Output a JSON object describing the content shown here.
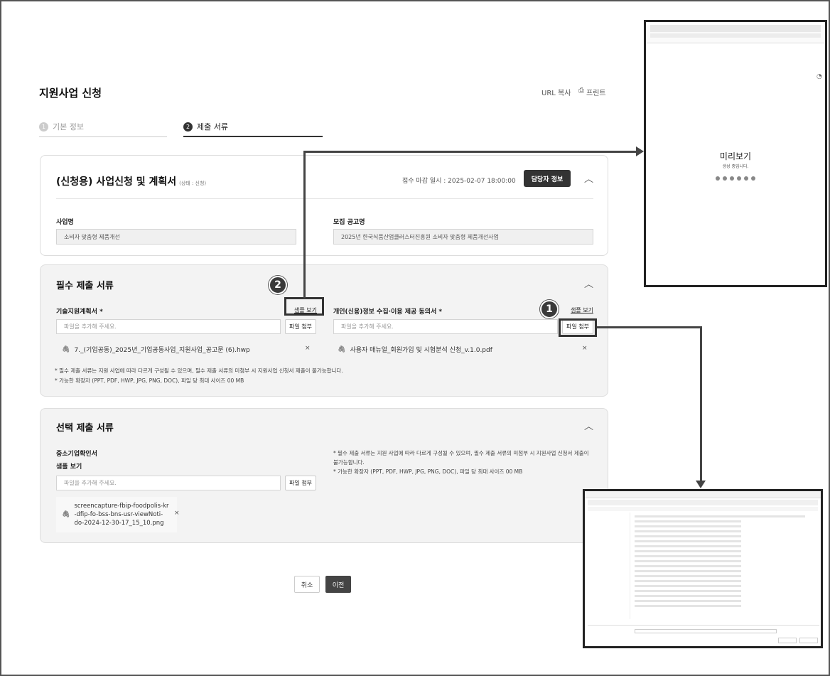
{
  "page": {
    "title": "지원사업 신청",
    "url_copy": "URL 복사",
    "print": "프린트"
  },
  "steps": [
    {
      "num": "1",
      "label": "기본 정보"
    },
    {
      "num": "2",
      "label": "제출 서류"
    }
  ],
  "plan_card": {
    "title": "(신청용) 사업신청 및 계획서",
    "status": "(상태 : 신청)",
    "deadline": "접수 마감 일시 : 2025-02-07 18:00:00",
    "contact_button": "담당자 정보",
    "business_name_label": "사업명",
    "business_name_value": "소비자 맞춤형 제품개선",
    "notice_label": "모집 공고명",
    "notice_value": "2025년 한국식품산업클러스터진흥원 소비자 맞춤형 제품개선사업"
  },
  "required_docs": {
    "title": "필수 제출 서류",
    "doc1": {
      "label": "기술지원계획서 *",
      "sample": "샘플 보기",
      "placeholder": "파일을 추가해 주세요.",
      "attach": "파일 첨부",
      "file": "7._(기업공동)_2025년_기업공동사업_지원사업_공고문 (6).hwp",
      "remove": "×"
    },
    "doc2": {
      "label": "개인(신용)정보 수집·이용 제공 동의서 *",
      "sample": "샘플 보기",
      "placeholder": "파일을 추가해 주세요.",
      "attach": "파일 첨부",
      "file": "사용자 매뉴얼_회원가입 및 시험분석 신청_v.1.0.pdf",
      "remove": "×"
    },
    "note1": "* 필수 제출 서류는 지원 사업에 따라 다르게 구성될 수 있으며, 필수 제출 서류의 미첨부 시 지원사업 신청서 제출이 불가능합니다.",
    "note2": "* 가능한 확장자 (PPT, PDF, HWP, JPG, PNG, DOC), 파일 당 최대 사이즈 00 MB"
  },
  "optional_docs": {
    "title": "선택 제출 서류",
    "doc_label": "중소기업확인서",
    "sample": "샘플 보기",
    "placeholder": "파일을 추가해 주세요.",
    "attach": "파일 첨부",
    "file_line1": "screencapture-fbip-foodpolis-kr",
    "file_line2": "-dfip-fo-bss-bns-usr-viewNoti-",
    "file_line3": "do-2024-12-30-17_15_10.png",
    "remove": "×",
    "note1a": "* 필수 제출 서류는 지원 사업에 따라 다르게 구성될 수 있으며, 필수 제출 서류의 미첨부 시 지원사업 신청서 제출이",
    "note1b": "불가능합니다.",
    "note2": "* 가능한 확장자 (PPT, PDF, HWP, JPG, PNG, DOC), 파일 당 최대 사이즈 00 MB"
  },
  "footer": {
    "cancel": "취소",
    "prev": "이전"
  },
  "callouts": {
    "badge1": "1",
    "badge2": "2"
  },
  "preview_window": {
    "title": "미리보기",
    "subtitle": "생성 중입니다."
  },
  "colors": {
    "dark": "#333333",
    "card_gray": "#f3f3f3",
    "border": "#dddddd"
  }
}
